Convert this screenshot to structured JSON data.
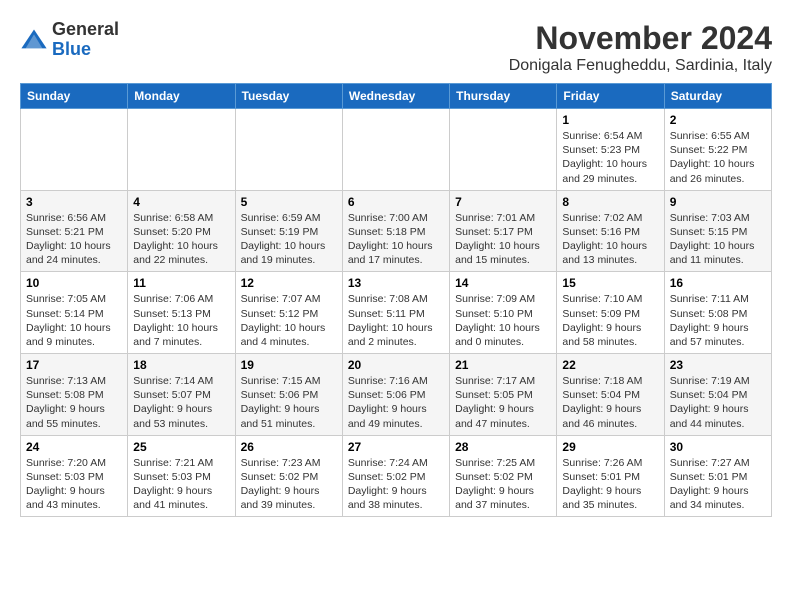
{
  "header": {
    "logo_general": "General",
    "logo_blue": "Blue",
    "month_title": "November 2024",
    "location": "Donigala Fenugheddu, Sardinia, Italy"
  },
  "days_of_week": [
    "Sunday",
    "Monday",
    "Tuesday",
    "Wednesday",
    "Thursday",
    "Friday",
    "Saturday"
  ],
  "weeks": [
    {
      "days": [
        {
          "num": "",
          "info": ""
        },
        {
          "num": "",
          "info": ""
        },
        {
          "num": "",
          "info": ""
        },
        {
          "num": "",
          "info": ""
        },
        {
          "num": "",
          "info": ""
        },
        {
          "num": "1",
          "info": "Sunrise: 6:54 AM\nSunset: 5:23 PM\nDaylight: 10 hours and 29 minutes."
        },
        {
          "num": "2",
          "info": "Sunrise: 6:55 AM\nSunset: 5:22 PM\nDaylight: 10 hours and 26 minutes."
        }
      ]
    },
    {
      "days": [
        {
          "num": "3",
          "info": "Sunrise: 6:56 AM\nSunset: 5:21 PM\nDaylight: 10 hours and 24 minutes."
        },
        {
          "num": "4",
          "info": "Sunrise: 6:58 AM\nSunset: 5:20 PM\nDaylight: 10 hours and 22 minutes."
        },
        {
          "num": "5",
          "info": "Sunrise: 6:59 AM\nSunset: 5:19 PM\nDaylight: 10 hours and 19 minutes."
        },
        {
          "num": "6",
          "info": "Sunrise: 7:00 AM\nSunset: 5:18 PM\nDaylight: 10 hours and 17 minutes."
        },
        {
          "num": "7",
          "info": "Sunrise: 7:01 AM\nSunset: 5:17 PM\nDaylight: 10 hours and 15 minutes."
        },
        {
          "num": "8",
          "info": "Sunrise: 7:02 AM\nSunset: 5:16 PM\nDaylight: 10 hours and 13 minutes."
        },
        {
          "num": "9",
          "info": "Sunrise: 7:03 AM\nSunset: 5:15 PM\nDaylight: 10 hours and 11 minutes."
        }
      ]
    },
    {
      "days": [
        {
          "num": "10",
          "info": "Sunrise: 7:05 AM\nSunset: 5:14 PM\nDaylight: 10 hours and 9 minutes."
        },
        {
          "num": "11",
          "info": "Sunrise: 7:06 AM\nSunset: 5:13 PM\nDaylight: 10 hours and 7 minutes."
        },
        {
          "num": "12",
          "info": "Sunrise: 7:07 AM\nSunset: 5:12 PM\nDaylight: 10 hours and 4 minutes."
        },
        {
          "num": "13",
          "info": "Sunrise: 7:08 AM\nSunset: 5:11 PM\nDaylight: 10 hours and 2 minutes."
        },
        {
          "num": "14",
          "info": "Sunrise: 7:09 AM\nSunset: 5:10 PM\nDaylight: 10 hours and 0 minutes."
        },
        {
          "num": "15",
          "info": "Sunrise: 7:10 AM\nSunset: 5:09 PM\nDaylight: 9 hours and 58 minutes."
        },
        {
          "num": "16",
          "info": "Sunrise: 7:11 AM\nSunset: 5:08 PM\nDaylight: 9 hours and 57 minutes."
        }
      ]
    },
    {
      "days": [
        {
          "num": "17",
          "info": "Sunrise: 7:13 AM\nSunset: 5:08 PM\nDaylight: 9 hours and 55 minutes."
        },
        {
          "num": "18",
          "info": "Sunrise: 7:14 AM\nSunset: 5:07 PM\nDaylight: 9 hours and 53 minutes."
        },
        {
          "num": "19",
          "info": "Sunrise: 7:15 AM\nSunset: 5:06 PM\nDaylight: 9 hours and 51 minutes."
        },
        {
          "num": "20",
          "info": "Sunrise: 7:16 AM\nSunset: 5:06 PM\nDaylight: 9 hours and 49 minutes."
        },
        {
          "num": "21",
          "info": "Sunrise: 7:17 AM\nSunset: 5:05 PM\nDaylight: 9 hours and 47 minutes."
        },
        {
          "num": "22",
          "info": "Sunrise: 7:18 AM\nSunset: 5:04 PM\nDaylight: 9 hours and 46 minutes."
        },
        {
          "num": "23",
          "info": "Sunrise: 7:19 AM\nSunset: 5:04 PM\nDaylight: 9 hours and 44 minutes."
        }
      ]
    },
    {
      "days": [
        {
          "num": "24",
          "info": "Sunrise: 7:20 AM\nSunset: 5:03 PM\nDaylight: 9 hours and 43 minutes."
        },
        {
          "num": "25",
          "info": "Sunrise: 7:21 AM\nSunset: 5:03 PM\nDaylight: 9 hours and 41 minutes."
        },
        {
          "num": "26",
          "info": "Sunrise: 7:23 AM\nSunset: 5:02 PM\nDaylight: 9 hours and 39 minutes."
        },
        {
          "num": "27",
          "info": "Sunrise: 7:24 AM\nSunset: 5:02 PM\nDaylight: 9 hours and 38 minutes."
        },
        {
          "num": "28",
          "info": "Sunrise: 7:25 AM\nSunset: 5:02 PM\nDaylight: 9 hours and 37 minutes."
        },
        {
          "num": "29",
          "info": "Sunrise: 7:26 AM\nSunset: 5:01 PM\nDaylight: 9 hours and 35 minutes."
        },
        {
          "num": "30",
          "info": "Sunrise: 7:27 AM\nSunset: 5:01 PM\nDaylight: 9 hours and 34 minutes."
        }
      ]
    }
  ]
}
